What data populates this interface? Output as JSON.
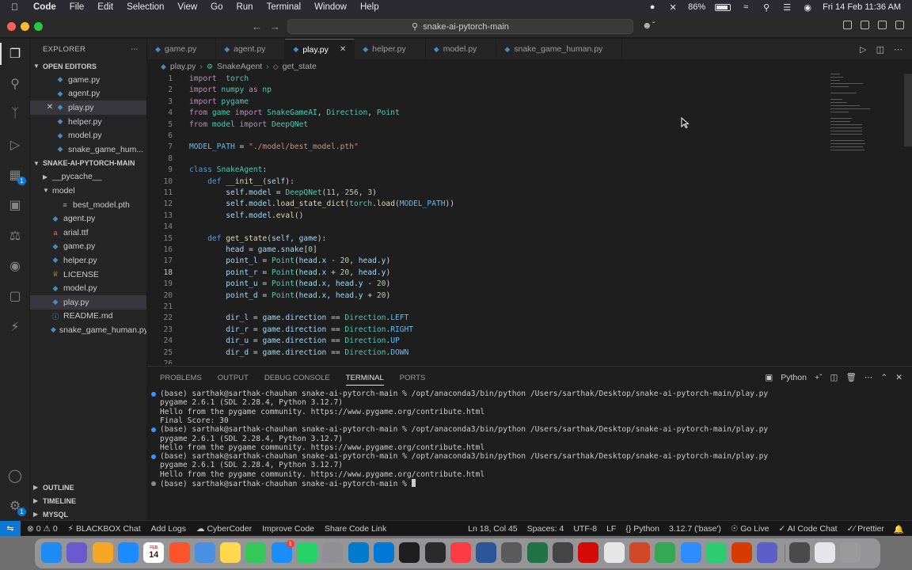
{
  "menubar": {
    "items": [
      "Code",
      "File",
      "Edit",
      "Selection",
      "View",
      "Go",
      "Run",
      "Terminal",
      "Window",
      "Help"
    ],
    "battery": "86%",
    "battery_level": 0.86,
    "datetime": "Fri 14 Feb  11:36 AM"
  },
  "titlebar": {
    "search_text": "snake-ai-pytorch-main"
  },
  "sidebar": {
    "title": "EXPLORER",
    "open_editors_label": "OPEN EDITORS",
    "open_editors": [
      "game.py",
      "agent.py",
      "play.py",
      "helper.py",
      "model.py",
      "snake_game_hum..."
    ],
    "project_label": "SNAKE-AI-PYTORCH-MAIN",
    "tree": [
      {
        "name": "__pycache__",
        "kind": "folder-collapsed"
      },
      {
        "name": "model",
        "kind": "folder-open"
      },
      {
        "name": "best_model.pth",
        "kind": "pth"
      },
      {
        "name": "agent.py",
        "kind": "py"
      },
      {
        "name": "arial.ttf",
        "kind": "ttf"
      },
      {
        "name": "game.py",
        "kind": "py"
      },
      {
        "name": "helper.py",
        "kind": "py"
      },
      {
        "name": "LICENSE",
        "kind": "license"
      },
      {
        "name": "model.py",
        "kind": "py"
      },
      {
        "name": "play.py",
        "kind": "py"
      },
      {
        "name": "README.md",
        "kind": "md"
      },
      {
        "name": "snake_game_human.py",
        "kind": "py"
      }
    ],
    "outline_label": "OUTLINE",
    "timeline_label": "TIMELINE",
    "mysql_label": "MYSQL",
    "scm_badge": "1"
  },
  "tabs": [
    {
      "label": "game.py",
      "active": false
    },
    {
      "label": "agent.py",
      "active": false
    },
    {
      "label": "play.py",
      "active": true
    },
    {
      "label": "helper.py",
      "active": false
    },
    {
      "label": "model.py",
      "active": false
    },
    {
      "label": "snake_game_human.py",
      "active": false
    }
  ],
  "breadcrumb": [
    "play.py",
    "SnakeAgent",
    "get_state"
  ],
  "editor": {
    "current_line": 18,
    "lines": [
      [
        [
          "kw2",
          "import"
        ],
        [
          "",
          "  "
        ],
        [
          "cls",
          "torch"
        ]
      ],
      [
        [
          "kw2",
          "import"
        ],
        [
          "",
          ""
        ],
        [
          "cls",
          " numpy"
        ],
        [
          "kw2",
          " as"
        ],
        [
          "cls",
          " np"
        ]
      ],
      [
        [
          "kw2",
          "import"
        ],
        [
          "cls",
          " pygame"
        ]
      ],
      [
        [
          "kw2",
          "from"
        ],
        [
          "cls",
          " game"
        ],
        [
          "kw2",
          " import"
        ],
        [
          "cls",
          " SnakeGameAI"
        ],
        [
          "",
          ", "
        ],
        [
          "cls",
          "Direction"
        ],
        [
          "",
          ", "
        ],
        [
          "cls",
          "Point"
        ]
      ],
      [
        [
          "kw2",
          "from"
        ],
        [
          "cls",
          " model"
        ],
        [
          "kw2",
          " import"
        ],
        [
          "cls",
          " DeepQNet"
        ]
      ],
      [],
      [
        [
          "const",
          "MODEL_PATH"
        ],
        [
          "",
          " = "
        ],
        [
          "str",
          "\"./model/best_model.pth\""
        ]
      ],
      [],
      [
        [
          "kw",
          "class"
        ],
        [
          "cls",
          " SnakeAgent"
        ],
        [
          "",
          ":"
        ]
      ],
      [
        [
          "",
          "    "
        ],
        [
          "kw",
          "def"
        ],
        [
          "fn",
          " __init__"
        ],
        [
          "",
          "("
        ],
        [
          "var",
          "self"
        ],
        [
          "",
          "):"
        ]
      ],
      [
        [
          "",
          "        "
        ],
        [
          "var",
          "self"
        ],
        [
          "",
          "."
        ],
        [
          "var",
          "model"
        ],
        [
          "",
          " = "
        ],
        [
          "cls",
          "DeepQNet"
        ],
        [
          "",
          "("
        ],
        [
          "num",
          "11"
        ],
        [
          "",
          ", "
        ],
        [
          "num",
          "256"
        ],
        [
          "",
          ", "
        ],
        [
          "num",
          "3"
        ],
        [
          "",
          ")"
        ]
      ],
      [
        [
          "",
          "        "
        ],
        [
          "var",
          "self"
        ],
        [
          "",
          "."
        ],
        [
          "var",
          "model"
        ],
        [
          "",
          "."
        ],
        [
          "fn",
          "load_state_dict"
        ],
        [
          "",
          "("
        ],
        [
          "cls",
          "torch"
        ],
        [
          "",
          "."
        ],
        [
          "fn",
          "load"
        ],
        [
          "",
          "("
        ],
        [
          "const",
          "MODEL_PATH"
        ],
        [
          "",
          "))"
        ]
      ],
      [
        [
          "",
          "        "
        ],
        [
          "var",
          "self"
        ],
        [
          "",
          "."
        ],
        [
          "var",
          "model"
        ],
        [
          "",
          "."
        ],
        [
          "fn",
          "eval"
        ],
        [
          "",
          "()"
        ]
      ],
      [],
      [
        [
          "",
          "    "
        ],
        [
          "kw",
          "def"
        ],
        [
          "fn",
          " get_state"
        ],
        [
          "",
          "("
        ],
        [
          "var",
          "self"
        ],
        [
          "",
          ", "
        ],
        [
          "var",
          "game"
        ],
        [
          "",
          "):"
        ]
      ],
      [
        [
          "",
          "        "
        ],
        [
          "var",
          "head"
        ],
        [
          "",
          " = "
        ],
        [
          "var",
          "game"
        ],
        [
          "",
          "."
        ],
        [
          "var",
          "snake"
        ],
        [
          "",
          "["
        ],
        [
          "num",
          "0"
        ],
        [
          "",
          "]"
        ]
      ],
      [
        [
          "",
          "        "
        ],
        [
          "var",
          "point_l"
        ],
        [
          "",
          " = "
        ],
        [
          "cls",
          "Point"
        ],
        [
          "",
          "("
        ],
        [
          "var",
          "head"
        ],
        [
          "",
          "."
        ],
        [
          "var",
          "x"
        ],
        [
          "",
          " - "
        ],
        [
          "num",
          "20"
        ],
        [
          "",
          ", "
        ],
        [
          "var",
          "head"
        ],
        [
          "",
          "."
        ],
        [
          "var",
          "y"
        ],
        [
          "",
          ")"
        ]
      ],
      [
        [
          "",
          "        "
        ],
        [
          "var",
          "point_r"
        ],
        [
          "",
          " = "
        ],
        [
          "cls",
          "Point"
        ],
        [
          "",
          "("
        ],
        [
          "var",
          "head"
        ],
        [
          "",
          "."
        ],
        [
          "var",
          "x"
        ],
        [
          "",
          " + "
        ],
        [
          "num",
          "20"
        ],
        [
          "",
          ", "
        ],
        [
          "var",
          "head"
        ],
        [
          "",
          "."
        ],
        [
          "var",
          "y"
        ],
        [
          "",
          ")"
        ]
      ],
      [
        [
          "",
          "        "
        ],
        [
          "var",
          "point_u"
        ],
        [
          "",
          " = "
        ],
        [
          "cls",
          "Point"
        ],
        [
          "",
          "("
        ],
        [
          "var",
          "head"
        ],
        [
          "",
          "."
        ],
        [
          "var",
          "x"
        ],
        [
          "",
          ", "
        ],
        [
          "var",
          "head"
        ],
        [
          "",
          "."
        ],
        [
          "var",
          "y"
        ],
        [
          "",
          " - "
        ],
        [
          "num",
          "20"
        ],
        [
          "",
          ")"
        ]
      ],
      [
        [
          "",
          "        "
        ],
        [
          "var",
          "point_d"
        ],
        [
          "",
          " = "
        ],
        [
          "cls",
          "Point"
        ],
        [
          "",
          "("
        ],
        [
          "var",
          "head"
        ],
        [
          "",
          "."
        ],
        [
          "var",
          "x"
        ],
        [
          "",
          ", "
        ],
        [
          "var",
          "head"
        ],
        [
          "",
          "."
        ],
        [
          "var",
          "y"
        ],
        [
          "",
          " + "
        ],
        [
          "num",
          "20"
        ],
        [
          "",
          ")"
        ]
      ],
      [],
      [
        [
          "",
          "        "
        ],
        [
          "var",
          "dir_l"
        ],
        [
          "",
          " = "
        ],
        [
          "var",
          "game"
        ],
        [
          "",
          "."
        ],
        [
          "var",
          "direction"
        ],
        [
          "",
          " == "
        ],
        [
          "cls",
          "Direction"
        ],
        [
          "",
          "."
        ],
        [
          "const",
          "LEFT"
        ]
      ],
      [
        [
          "",
          "        "
        ],
        [
          "var",
          "dir_r"
        ],
        [
          "",
          " = "
        ],
        [
          "var",
          "game"
        ],
        [
          "",
          "."
        ],
        [
          "var",
          "direction"
        ],
        [
          "",
          " == "
        ],
        [
          "cls",
          "Direction"
        ],
        [
          "",
          "."
        ],
        [
          "const",
          "RIGHT"
        ]
      ],
      [
        [
          "",
          "        "
        ],
        [
          "var",
          "dir_u"
        ],
        [
          "",
          " = "
        ],
        [
          "var",
          "game"
        ],
        [
          "",
          "."
        ],
        [
          "var",
          "direction"
        ],
        [
          "",
          " == "
        ],
        [
          "cls",
          "Direction"
        ],
        [
          "",
          "."
        ],
        [
          "const",
          "UP"
        ]
      ],
      [
        [
          "",
          "        "
        ],
        [
          "var",
          "dir_d"
        ],
        [
          "",
          " = "
        ],
        [
          "var",
          "game"
        ],
        [
          "",
          "."
        ],
        [
          "var",
          "direction"
        ],
        [
          "",
          " == "
        ],
        [
          "cls",
          "Direction"
        ],
        [
          "",
          "."
        ],
        [
          "const",
          "DOWN"
        ]
      ],
      []
    ]
  },
  "panel": {
    "tabs": [
      "PROBLEMS",
      "OUTPUT",
      "DEBUG CONSOLE",
      "TERMINAL",
      "PORTS"
    ],
    "active_tab": "TERMINAL",
    "shell_label": "Python",
    "terminal_lines": [
      {
        "text": "(base) sarthak@sarthak-chauhan snake-ai-pytorch-main % /opt/anaconda3/bin/python /Users/sarthak/Desktop/snake-ai-pytorch-main/play.py",
        "dot": "blue"
      },
      {
        "text": "pygame 2.6.1 (SDL 2.28.4, Python 3.12.7)",
        "dot": ""
      },
      {
        "text": "Hello from the pygame community. https://www.pygame.org/contribute.html",
        "dot": ""
      },
      {
        "text": "Final Score: 30",
        "dot": ""
      },
      {
        "text": "(base) sarthak@sarthak-chauhan snake-ai-pytorch-main % /opt/anaconda3/bin/python /Users/sarthak/Desktop/snake-ai-pytorch-main/play.py",
        "dot": "blue"
      },
      {
        "text": "pygame 2.6.1 (SDL 2.28.4, Python 3.12.7)",
        "dot": ""
      },
      {
        "text": "Hello from the pygame community. https://www.pygame.org/contribute.html",
        "dot": ""
      },
      {
        "text": "(base) sarthak@sarthak-chauhan snake-ai-pytorch-main % /opt/anaconda3/bin/python /Users/sarthak/Desktop/snake-ai-pytorch-main/play.py",
        "dot": "blue"
      },
      {
        "text": "pygame 2.6.1 (SDL 2.28.4, Python 3.12.7)",
        "dot": ""
      },
      {
        "text": "Hello from the pygame community. https://www.pygame.org/contribute.html",
        "dot": ""
      },
      {
        "text": "(base) sarthak@sarthak-chauhan snake-ai-pytorch-main % ",
        "dot": "grey",
        "cursor": true
      }
    ]
  },
  "statusbar": {
    "problems_errors": "0",
    "problems_warnings": "0",
    "left_items": [
      "BLACKBOX Chat",
      "Add Logs",
      "CyberCoder",
      "Improve Code",
      "Share Code Link"
    ],
    "cursor_pos": "Ln 18, Col 45",
    "spaces": "Spaces: 4",
    "encoding": "UTF-8",
    "eol": "LF",
    "language": "Python",
    "interpreter": "3.12.7 ('base')",
    "go_live": "Go Live",
    "ai_chat": "AI Code Chat",
    "prettier": "Prettier"
  },
  "dock": {
    "calendar_month": "FEB",
    "calendar_day": "14",
    "appstore_badge": "1",
    "colors": [
      "#1e8bf0",
      "#6a5acd",
      "#f5a623",
      "#1a8cff",
      "#ffffff",
      "#fb542b",
      "#4a90e2",
      "#ffd84d",
      "#34c759",
      "#1c8ef9",
      "#25d366",
      "#8e8e93",
      "#007acc",
      "#0078d4",
      "#1e1e1e",
      "#2b2b2b",
      "#fc3c44",
      "#2b579a",
      "#5a5a5a",
      "#217346",
      "#444444",
      "#d70a0a",
      "#e6e6e6",
      "#d24726",
      "#34a853",
      "#2d8cff",
      "#2ecc71",
      "#d83b01",
      "#5b5fc7",
      "#4a4a4a",
      "#e5e5ea",
      "#9a9a9a"
    ]
  }
}
